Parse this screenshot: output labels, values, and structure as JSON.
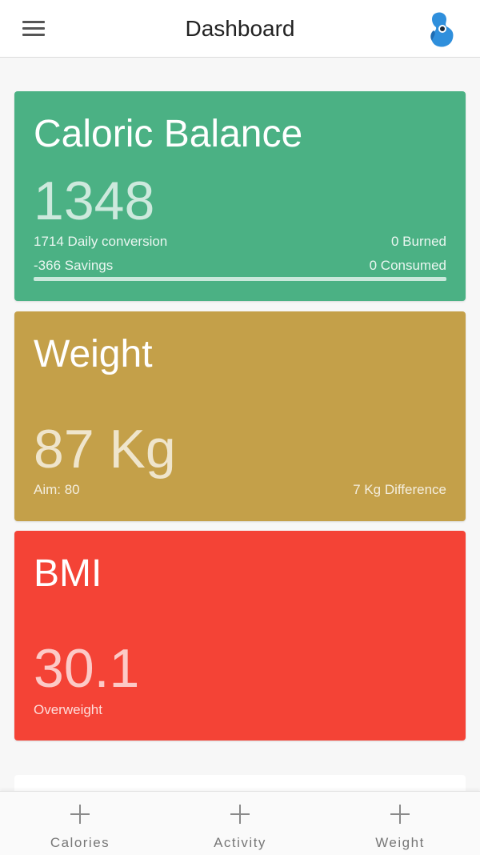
{
  "header": {
    "title": "Dashboard",
    "menu_icon": "hamburger-menu-icon",
    "logo_icon": "blue-bean-logo-icon"
  },
  "cards": {
    "caloric": {
      "title": "Caloric Balance",
      "value": "1348",
      "daily_conversion": "1714 Daily conversion",
      "burned": "0 Burned",
      "savings": "-366 Savings",
      "consumed": "0 Consumed",
      "progress_fraction": 1.0,
      "color": "#4bb184"
    },
    "weight": {
      "title": "Weight",
      "value": "87 Kg",
      "aim": "Aim: 80",
      "difference": "7 Kg Difference",
      "color": "#c4a049"
    },
    "bmi": {
      "title": "BMI",
      "value": "30.1",
      "status": "Overweight",
      "color": "#f44336"
    }
  },
  "bottom_nav": {
    "items": [
      {
        "label": "Calories",
        "icon": "plus-icon"
      },
      {
        "label": "Activity",
        "icon": "plus-icon"
      },
      {
        "label": "Weight",
        "icon": "plus-icon"
      }
    ]
  }
}
